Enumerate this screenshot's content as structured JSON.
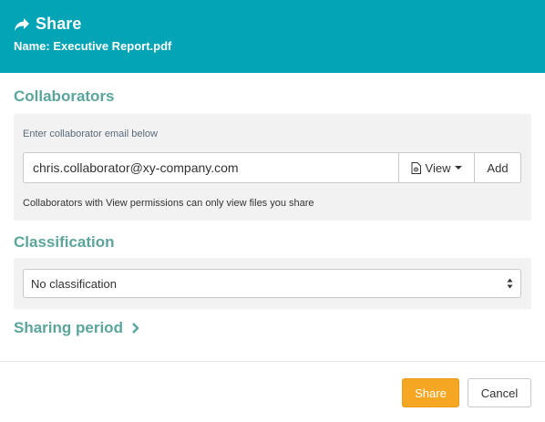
{
  "header": {
    "title": "Share",
    "file_name": "Name: Executive Report.pdf",
    "background_color": "#03a4b5",
    "icon": "share-arrow-icon"
  },
  "collaborators": {
    "title": "Collaborators",
    "hint": "Enter collaborator email below",
    "email_value": "chris.collaborator@xy-company.com",
    "permission_label": "View",
    "permission_icon": "document-icon",
    "add_label": "Add",
    "note": "Collaborators with View permissions can only view files you share"
  },
  "classification": {
    "title": "Classification",
    "selected": "No classification"
  },
  "sharing_period": {
    "title": "Sharing period",
    "icon": "chevron-right-icon"
  },
  "footer": {
    "share_label": "Share",
    "cancel_label": "Cancel",
    "share_color": "#f5a623"
  }
}
